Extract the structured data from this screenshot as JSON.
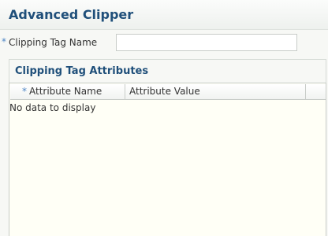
{
  "panel": {
    "title": "Advanced Clipper"
  },
  "clipping_tag_name": {
    "required_marker": "*",
    "label": "Clipping Tag Name",
    "value": ""
  },
  "attributes_section": {
    "title": "Clipping Tag Attributes",
    "columns": [
      {
        "required_marker": "*",
        "label": "Attribute Name"
      },
      {
        "label": "Attribute Value"
      }
    ],
    "empty_message": "No data to display"
  }
}
